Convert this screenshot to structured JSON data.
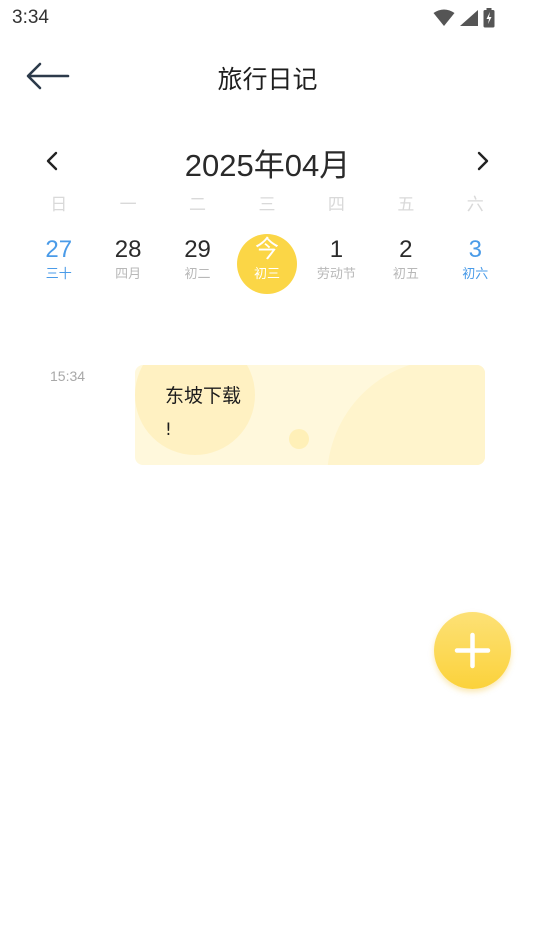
{
  "status_bar": {
    "time": "3:34",
    "icons": [
      "wifi-icon",
      "signal-icon",
      "battery-charging-icon"
    ]
  },
  "header": {
    "title": "旅行日记",
    "back_icon": "arrow-left-icon"
  },
  "calendar": {
    "month_label": "2025年04月",
    "weekdays": [
      "日",
      "一",
      "二",
      "三",
      "四",
      "五",
      "六"
    ],
    "days": [
      {
        "num": "27",
        "sub": "三十",
        "weekend": true
      },
      {
        "num": "28",
        "sub": "四月",
        "weekend": false
      },
      {
        "num": "29",
        "sub": "初二",
        "weekend": false
      },
      {
        "num": "今",
        "sub": "初三",
        "weekend": false,
        "today": true
      },
      {
        "num": "1",
        "sub": "劳动节",
        "weekend": false
      },
      {
        "num": "2",
        "sub": "初五",
        "weekend": false
      },
      {
        "num": "3",
        "sub": "初六",
        "weekend": true
      }
    ]
  },
  "entries": [
    {
      "time": "15:34",
      "title": "东坡下载",
      "body": "!"
    }
  ],
  "fab": {
    "icon": "plus-icon"
  },
  "colors": {
    "accent": "#fbd646",
    "weekend": "#4a9be8",
    "card_bg": "#fff8dc"
  }
}
